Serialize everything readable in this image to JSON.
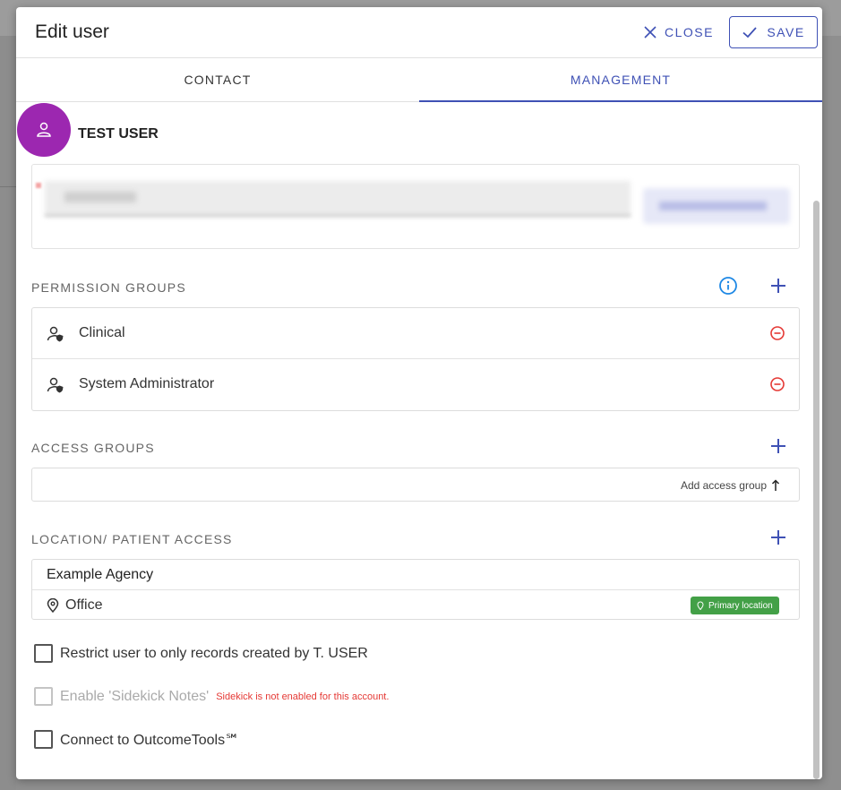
{
  "dialog": {
    "title": "Edit user",
    "close_label": "CLOSE",
    "save_label": "SAVE"
  },
  "tabs": [
    {
      "label": "CONTACT",
      "active": false
    },
    {
      "label": "MANAGEMENT",
      "active": true
    }
  ],
  "user": {
    "name": "TEST USER",
    "avatar_color": "#9c27b0"
  },
  "permission_groups": {
    "label": "PERMISSION GROUPS",
    "items": [
      {
        "label": "Clinical"
      },
      {
        "label": "System Administrator"
      }
    ]
  },
  "access_groups": {
    "label": "ACCESS GROUPS",
    "add_label": "Add access group"
  },
  "location_access": {
    "label": "LOCATION/ PATIENT ACCESS",
    "agency": "Example Agency",
    "location": "Office",
    "badge": "Primary location"
  },
  "options": {
    "restrict_label": "Restrict user to only records created by T. USER",
    "sidekick_label": "Enable 'Sidekick Notes'",
    "sidekick_note": "Sidekick is not enabled for this account.",
    "outcome_label": "Connect to OutcomeTools℠"
  },
  "colors": {
    "accent": "#3f51b5",
    "remove": "#e53935",
    "info": "#1e88e5",
    "badge": "#43a047"
  }
}
